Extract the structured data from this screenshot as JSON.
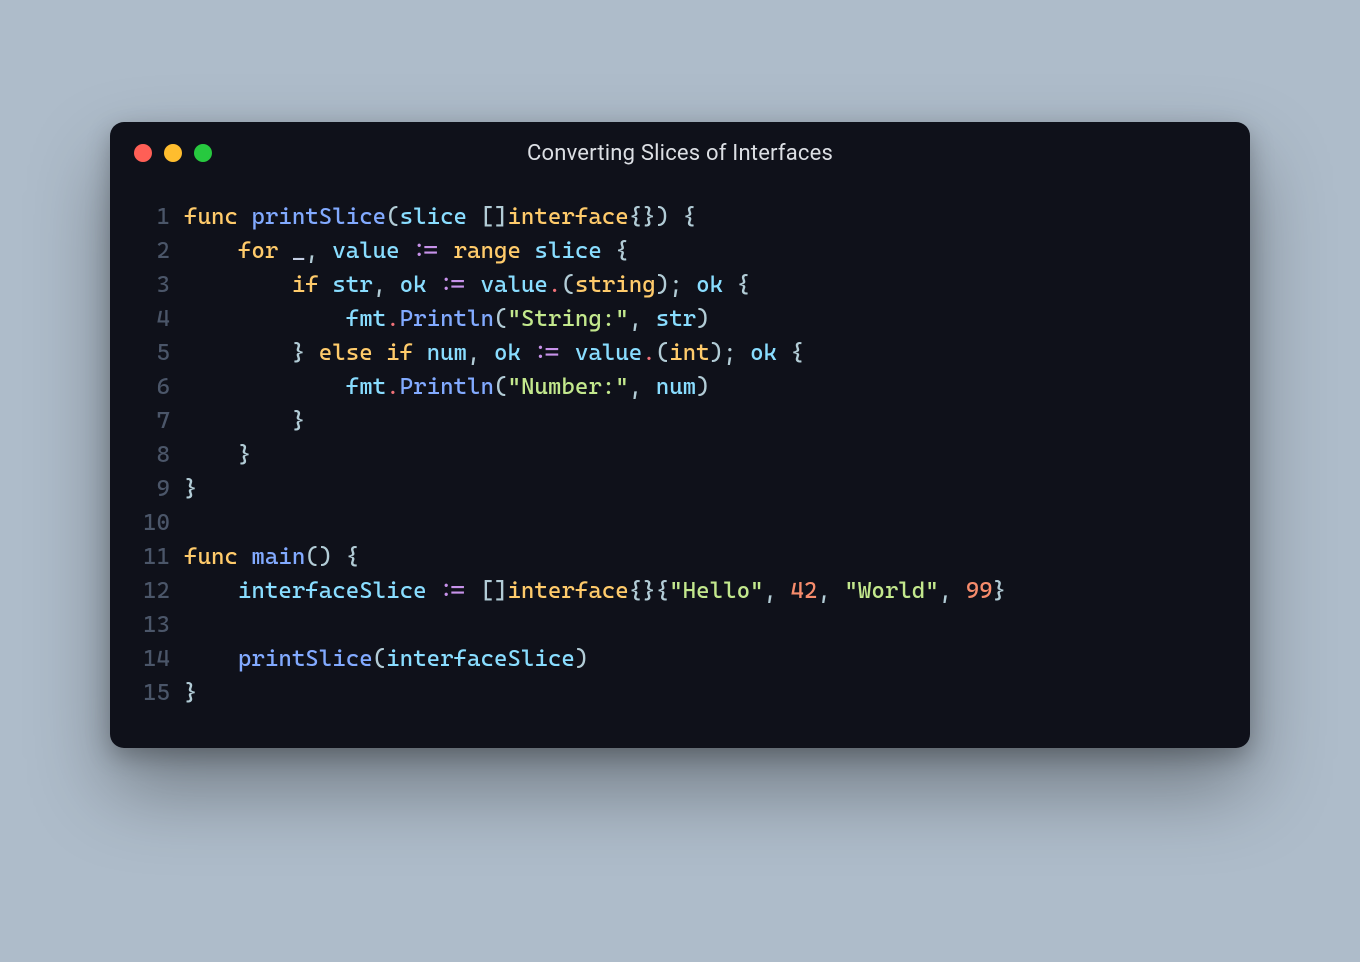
{
  "window": {
    "title": "Converting Slices of Interfaces",
    "traffic_light_colors": {
      "red": "#ff5f56",
      "yellow": "#ffbd2e",
      "green": "#27c93f"
    }
  },
  "code": {
    "language": "go",
    "line_count": 15,
    "lines": [
      "func printSlice(slice []interface{}) {",
      "    for _, value := range slice {",
      "        if str, ok := value.(string); ok {",
      "            fmt.Println(\"String:\", str)",
      "        } else if num, ok := value.(int); ok {",
      "            fmt.Println(\"Number:\", num)",
      "        }",
      "    }",
      "}",
      "",
      "func main() {",
      "    interfaceSlice := []interface{}{\"Hello\", 42, \"World\", 99}",
      "",
      "    printSlice(interfaceSlice)",
      "}"
    ],
    "tokens": [
      [
        [
          "func ",
          "keyword"
        ],
        [
          "printSlice",
          "func"
        ],
        [
          "(",
          "punct"
        ],
        [
          "slice ",
          "ident"
        ],
        [
          "[]",
          "punct"
        ],
        [
          "interface",
          "keyword"
        ],
        [
          "{}) {",
          "punct"
        ]
      ],
      [
        [
          "    ",
          "plain"
        ],
        [
          "for ",
          "keyword"
        ],
        [
          "_",
          "ident2"
        ],
        [
          ", ",
          "punct"
        ],
        [
          "value ",
          "ident"
        ],
        [
          ":=",
          "op"
        ],
        [
          " ",
          "plain"
        ],
        [
          "range ",
          "keyword"
        ],
        [
          "slice ",
          "ident"
        ],
        [
          "{",
          "punct"
        ]
      ],
      [
        [
          "        ",
          "plain"
        ],
        [
          "if ",
          "keyword"
        ],
        [
          "str",
          "ident"
        ],
        [
          ", ",
          "punct"
        ],
        [
          "ok ",
          "ident"
        ],
        [
          ":=",
          "op"
        ],
        [
          " ",
          "plain"
        ],
        [
          "value",
          "ident"
        ],
        [
          ".",
          "dot"
        ],
        [
          "(",
          "punct"
        ],
        [
          "string",
          "type"
        ],
        [
          "); ",
          "punct"
        ],
        [
          "ok ",
          "ident"
        ],
        [
          "{",
          "punct"
        ]
      ],
      [
        [
          "            ",
          "plain"
        ],
        [
          "fmt",
          "ident"
        ],
        [
          ".",
          "dot"
        ],
        [
          "Println",
          "func"
        ],
        [
          "(",
          "punct"
        ],
        [
          "\"String:\"",
          "string"
        ],
        [
          ", ",
          "punct"
        ],
        [
          "str",
          "ident"
        ],
        [
          ")",
          "punct"
        ]
      ],
      [
        [
          "        ",
          "plain"
        ],
        [
          "} ",
          "punct"
        ],
        [
          "else if ",
          "keyword"
        ],
        [
          "num",
          "ident"
        ],
        [
          ", ",
          "punct"
        ],
        [
          "ok ",
          "ident"
        ],
        [
          ":=",
          "op"
        ],
        [
          " ",
          "plain"
        ],
        [
          "value",
          "ident"
        ],
        [
          ".",
          "dot"
        ],
        [
          "(",
          "punct"
        ],
        [
          "int",
          "type"
        ],
        [
          "); ",
          "punct"
        ],
        [
          "ok ",
          "ident"
        ],
        [
          "{",
          "punct"
        ]
      ],
      [
        [
          "            ",
          "plain"
        ],
        [
          "fmt",
          "ident"
        ],
        [
          ".",
          "dot"
        ],
        [
          "Println",
          "func"
        ],
        [
          "(",
          "punct"
        ],
        [
          "\"Number:\"",
          "string"
        ],
        [
          ", ",
          "punct"
        ],
        [
          "num",
          "ident"
        ],
        [
          ")",
          "punct"
        ]
      ],
      [
        [
          "        ",
          "plain"
        ],
        [
          "}",
          "punct"
        ]
      ],
      [
        [
          "    ",
          "plain"
        ],
        [
          "}",
          "punct"
        ]
      ],
      [
        [
          "}",
          "punct"
        ]
      ],
      [],
      [
        [
          "func ",
          "keyword"
        ],
        [
          "main",
          "func"
        ],
        [
          "() {",
          "punct"
        ]
      ],
      [
        [
          "    ",
          "plain"
        ],
        [
          "interfaceSlice ",
          "ident"
        ],
        [
          ":=",
          "op"
        ],
        [
          " ",
          "plain"
        ],
        [
          "[]",
          "punct"
        ],
        [
          "interface",
          "keyword"
        ],
        [
          "{}{",
          "punct"
        ],
        [
          "\"Hello\"",
          "string"
        ],
        [
          ", ",
          "punct"
        ],
        [
          "42",
          "number"
        ],
        [
          ", ",
          "punct"
        ],
        [
          "\"World\"",
          "string"
        ],
        [
          ", ",
          "punct"
        ],
        [
          "99",
          "number"
        ],
        [
          "}",
          "punct"
        ]
      ],
      [],
      [
        [
          "    ",
          "plain"
        ],
        [
          "printSlice",
          "func"
        ],
        [
          "(",
          "punct"
        ],
        [
          "interfaceSlice",
          "ident"
        ],
        [
          ")",
          "punct"
        ]
      ],
      [
        [
          "}",
          "punct"
        ]
      ]
    ]
  }
}
